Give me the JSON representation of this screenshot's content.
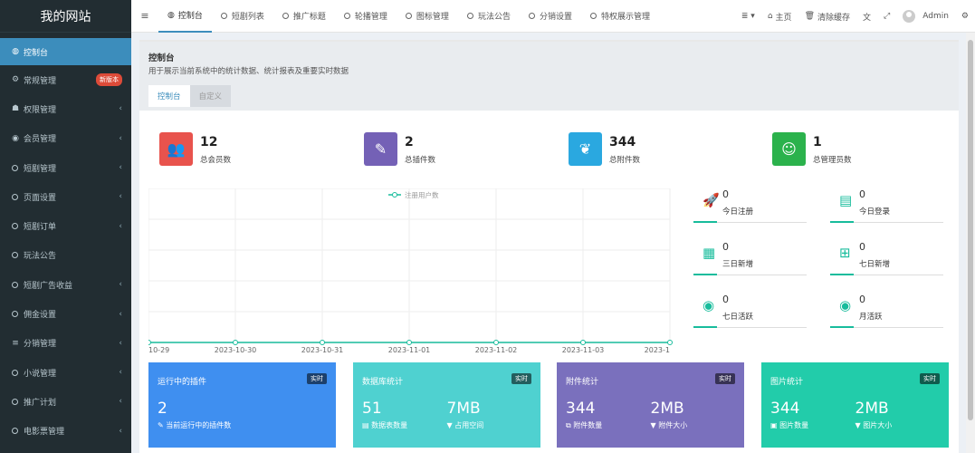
{
  "sidebar": {
    "logo": "我的网站",
    "items": [
      {
        "label": "控制台",
        "icon": "dashboard-icon"
      },
      {
        "label": "常规管理",
        "icon": "cogs-icon",
        "badge": "新版本"
      },
      {
        "label": "权限管理",
        "icon": "group-icon"
      },
      {
        "label": "会员管理",
        "icon": "user-circle-icon"
      },
      {
        "label": "短剧管理",
        "icon": "circle-o-icon"
      },
      {
        "label": "页面设置",
        "icon": "circle-o-icon"
      },
      {
        "label": "短剧订单",
        "icon": "circle-o-icon"
      },
      {
        "label": "玩法公告",
        "icon": "circle-o-icon"
      },
      {
        "label": "短剧广告收益",
        "icon": "circle-o-icon"
      },
      {
        "label": "佣金设置",
        "icon": "circle-o-icon"
      },
      {
        "label": "分销管理",
        "icon": "list-icon"
      },
      {
        "label": "小说管理",
        "icon": "circle-o-icon"
      },
      {
        "label": "推广计划",
        "icon": "circle-o-icon"
      },
      {
        "label": "电影票管理",
        "icon": "circle-o-icon"
      }
    ]
  },
  "navbar": {
    "tabs": [
      "控制台",
      "短剧列表",
      "推广标题",
      "轮播管理",
      "图标管理",
      "玩法公告",
      "分销设置",
      "特权展示管理"
    ],
    "home": "主页",
    "clear_cache": "清除缓存",
    "user": "Admin"
  },
  "header": {
    "title": "控制台",
    "description": "用于展示当前系统中的统计数据、统计报表及重要实时数据",
    "tabs": [
      "控制台",
      "自定义"
    ]
  },
  "stats": [
    {
      "value": "12",
      "label": "总会员数",
      "color": "#e8534d",
      "icon": "users-icon"
    },
    {
      "value": "2",
      "label": "总插件数",
      "color": "#7461b6",
      "icon": "magic-icon"
    },
    {
      "value": "344",
      "label": "总附件数",
      "color": "#2aa8e0",
      "icon": "leaf-icon"
    },
    {
      "value": "1",
      "label": "总管理员数",
      "color": "#2bb24c",
      "icon": "user-icon"
    }
  ],
  "chart_data": {
    "type": "line",
    "legend": "注册用户数",
    "categories": [
      "10-29",
      "2023-10-30",
      "2023-10-31",
      "2023-11-01",
      "2023-11-02",
      "2023-11-03",
      "2023-1"
    ],
    "series": [
      {
        "name": "注册用户数",
        "values": [
          0,
          0,
          0,
          0,
          0,
          0,
          0
        ]
      }
    ],
    "color": "#18bc9c"
  },
  "mini_stats": [
    {
      "value": "0",
      "label": "今日注册",
      "icon": "rocket-icon"
    },
    {
      "value": "0",
      "label": "今日登录",
      "icon": "vcard-icon"
    },
    {
      "value": "0",
      "label": "三日新增",
      "icon": "calendar-icon"
    },
    {
      "value": "0",
      "label": "七日新增",
      "icon": "calendar-plus-icon"
    },
    {
      "value": "0",
      "label": "七日活跃",
      "icon": "user-circle-icon"
    },
    {
      "value": "0",
      "label": "月活跃",
      "icon": "user-circle-icon"
    }
  ],
  "cards": [
    {
      "title": "运行中的插件",
      "tag": "实时",
      "v1": "2",
      "s1": "当前运行中的插件数",
      "v2": "",
      "s2": "",
      "color": "#3f8ff0"
    },
    {
      "title": "数据库统计",
      "tag": "实时",
      "v1": "51",
      "s1": "数据表数量",
      "v2": "7MB",
      "s2": "占用空间",
      "color": "#4fd1d0"
    },
    {
      "title": "附件统计",
      "tag": "实时",
      "v1": "344",
      "s1": "附件数量",
      "v2": "2MB",
      "s2": "附件大小",
      "color": "#7a70bd"
    },
    {
      "title": "图片统计",
      "tag": "实时",
      "v1": "344",
      "s1": "图片数量",
      "v2": "2MB",
      "s2": "图片大小",
      "color": "#22ccaa"
    }
  ]
}
